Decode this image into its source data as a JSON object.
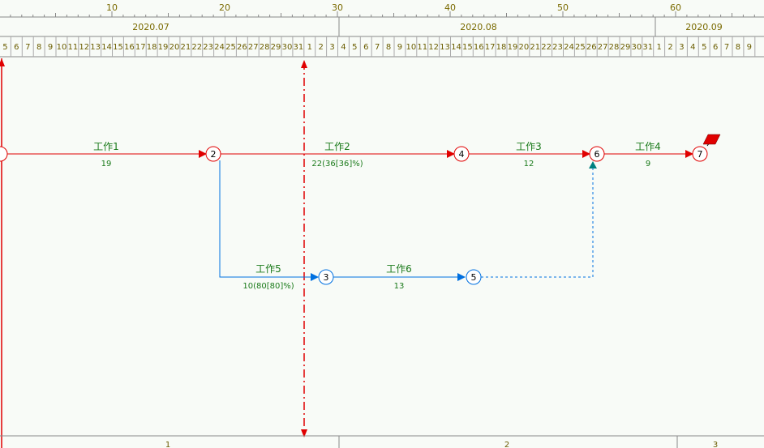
{
  "scale": {
    "ticks": [
      "10",
      "20",
      "30",
      "40",
      "50",
      "60"
    ]
  },
  "months": [
    {
      "label": "2020.07"
    },
    {
      "label": "2020.08"
    },
    {
      "label": "2020.09"
    }
  ],
  "days": [
    "5",
    "6",
    "7",
    "8",
    "9",
    "10",
    "11",
    "12",
    "13",
    "14",
    "15",
    "16",
    "17",
    "18",
    "19",
    "20",
    "21",
    "22",
    "23",
    "24",
    "25",
    "26",
    "27",
    "28",
    "29",
    "30",
    "31",
    "1",
    "2",
    "3",
    "4",
    "5",
    "6",
    "7",
    "8",
    "9",
    "10",
    "11",
    "12",
    "13",
    "14",
    "15",
    "16",
    "17",
    "18",
    "19",
    "20",
    "21",
    "22",
    "23",
    "24",
    "25",
    "26",
    "27",
    "28",
    "29",
    "30",
    "31",
    "1",
    "2",
    "3",
    "4",
    "5",
    "6",
    "7",
    "8",
    "9"
  ],
  "nodes": [
    {
      "id": "1",
      "label": "",
      "color": "#e00000"
    },
    {
      "id": "2",
      "label": "2",
      "color": "#e00000"
    },
    {
      "id": "3",
      "label": "3",
      "color": "#0070e0"
    },
    {
      "id": "4",
      "label": "4",
      "color": "#e00000"
    },
    {
      "id": "5",
      "label": "5",
      "color": "#0070e0"
    },
    {
      "id": "6",
      "label": "6",
      "color": "#e00000"
    },
    {
      "id": "7",
      "label": "7",
      "color": "#e00000"
    }
  ],
  "tasks": [
    {
      "name": "工作1",
      "duration": "19",
      "color": "#e00000"
    },
    {
      "name": "工作2",
      "duration": "22(36[36]%)",
      "color": "#e00000"
    },
    {
      "name": "工作3",
      "duration": "12",
      "color": "#e00000"
    },
    {
      "name": "工作4",
      "duration": "9",
      "color": "#e00000"
    },
    {
      "name": "工作5",
      "duration": "10(80[80]%)",
      "color": "#0070e0"
    },
    {
      "name": "工作6",
      "duration": "13",
      "color": "#0070e0"
    }
  ],
  "footer": [
    "1",
    "2",
    "3"
  ],
  "colors": {
    "critical": "#e00000",
    "normal": "#0070e0",
    "dummy": "#0070e0",
    "text": "#1a7a1a",
    "scale_text": "#7a6a00"
  }
}
